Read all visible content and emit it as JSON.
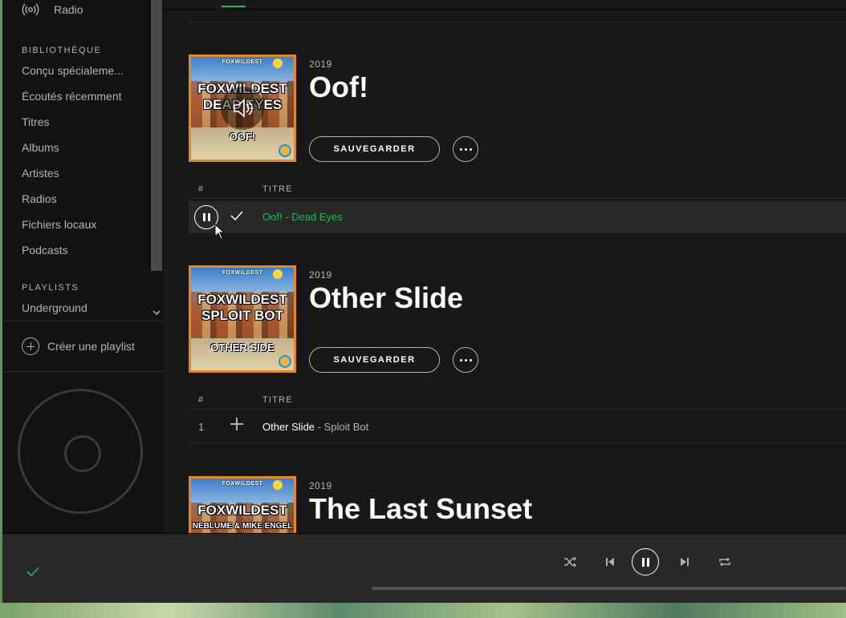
{
  "sidebar": {
    "radio_label": "Radio",
    "library_title": "BIBLIOTHÈQUE",
    "library_items": [
      "Conçu spécialeme...",
      "Écoutés récemment",
      "Titres",
      "Albums",
      "Artistes",
      "Radios",
      "Fichiers locaux",
      "Podcasts"
    ],
    "playlists_title": "PLAYLISTS",
    "playlists": [
      "Underground"
    ],
    "create_playlist_label": "Créer une playlist"
  },
  "columns": {
    "hash": "#",
    "title": "TITRE"
  },
  "albums": [
    {
      "year": "2019",
      "title": "Oof!",
      "save_label": "SAUVEGARDER",
      "cover": {
        "brand": "FOXWILDEST",
        "title_line1": "FOXWILDEST",
        "title_line2": "DEAD EYES",
        "subtitle": "OOF!"
      },
      "tracks": [
        {
          "number": "",
          "song": "Oof!",
          "separator": " - ",
          "artist": "Dead Eyes",
          "state": "playing",
          "saved": true
        }
      ]
    },
    {
      "year": "2019",
      "title": "Other Slide",
      "save_label": "SAUVEGARDER",
      "cover": {
        "brand": "FOXWILDEST",
        "title_line1": "FOXWILDEST",
        "title_line2": "SPLOIT BOT",
        "subtitle": "OTHER SIDE"
      },
      "tracks": [
        {
          "number": "1",
          "song": "Other Slide",
          "separator": " - ",
          "artist": "Sploit Bot",
          "state": "idle",
          "saved": false
        }
      ]
    },
    {
      "year": "2019",
      "title": "The Last Sunset",
      "cover": {
        "brand": "FOXWILDEST",
        "title_line1": "FOXWILDEST",
        "title_line2": "NEBLUME & MIKE ENGEL",
        "subtitle": ""
      }
    }
  ],
  "player": {
    "is_playing": true,
    "progress": 0.0
  },
  "colors": {
    "accent": "#1db954",
    "background": "#181818",
    "sidebar": "#121212",
    "player_bar": "#282828",
    "cover_border": "#e08a2c"
  }
}
